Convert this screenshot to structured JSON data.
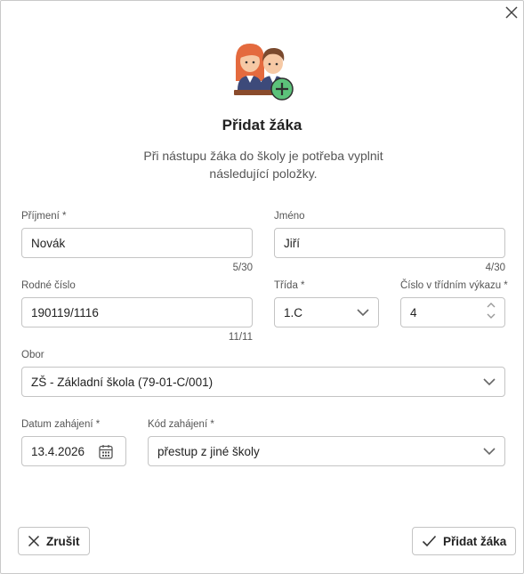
{
  "dialog": {
    "title": "Přidat žáka",
    "subtitle": "Při nástupu žáka do školy je potřeba vyplnit následující položky."
  },
  "fields": {
    "prijmeni": {
      "label": "Příjmení *",
      "value": "Novák",
      "counter": "5/30"
    },
    "jmeno": {
      "label": "Jméno",
      "value": "Jiří",
      "counter": "4/30"
    },
    "rodne_cislo": {
      "label": "Rodné číslo",
      "value": "190119/1116",
      "counter": "11/11"
    },
    "trida": {
      "label": "Třída *",
      "value": "1.C"
    },
    "cislo_vykaz": {
      "label": "Číslo v třídním výkazu *",
      "value": "4"
    },
    "obor": {
      "label": "Obor",
      "value": "ZŠ - Základní škola (79-01-C/001)"
    },
    "datum": {
      "label": "Datum zahájení *",
      "value": "13.4.2026"
    },
    "kod": {
      "label": "Kód zahájení *",
      "value": "přestup z jiné školy"
    }
  },
  "buttons": {
    "cancel": "Zrušit",
    "submit": "Přidat žáka"
  },
  "icons": {
    "close": "close-icon",
    "students": "students-icon",
    "add": "plus-circle-icon",
    "chevron": "chevron-down-icon",
    "calendar": "calendar-icon",
    "check": "check-icon",
    "x": "x-icon"
  },
  "colors": {
    "accent_green": "#5cc27a",
    "border": "#c4c4c4"
  }
}
